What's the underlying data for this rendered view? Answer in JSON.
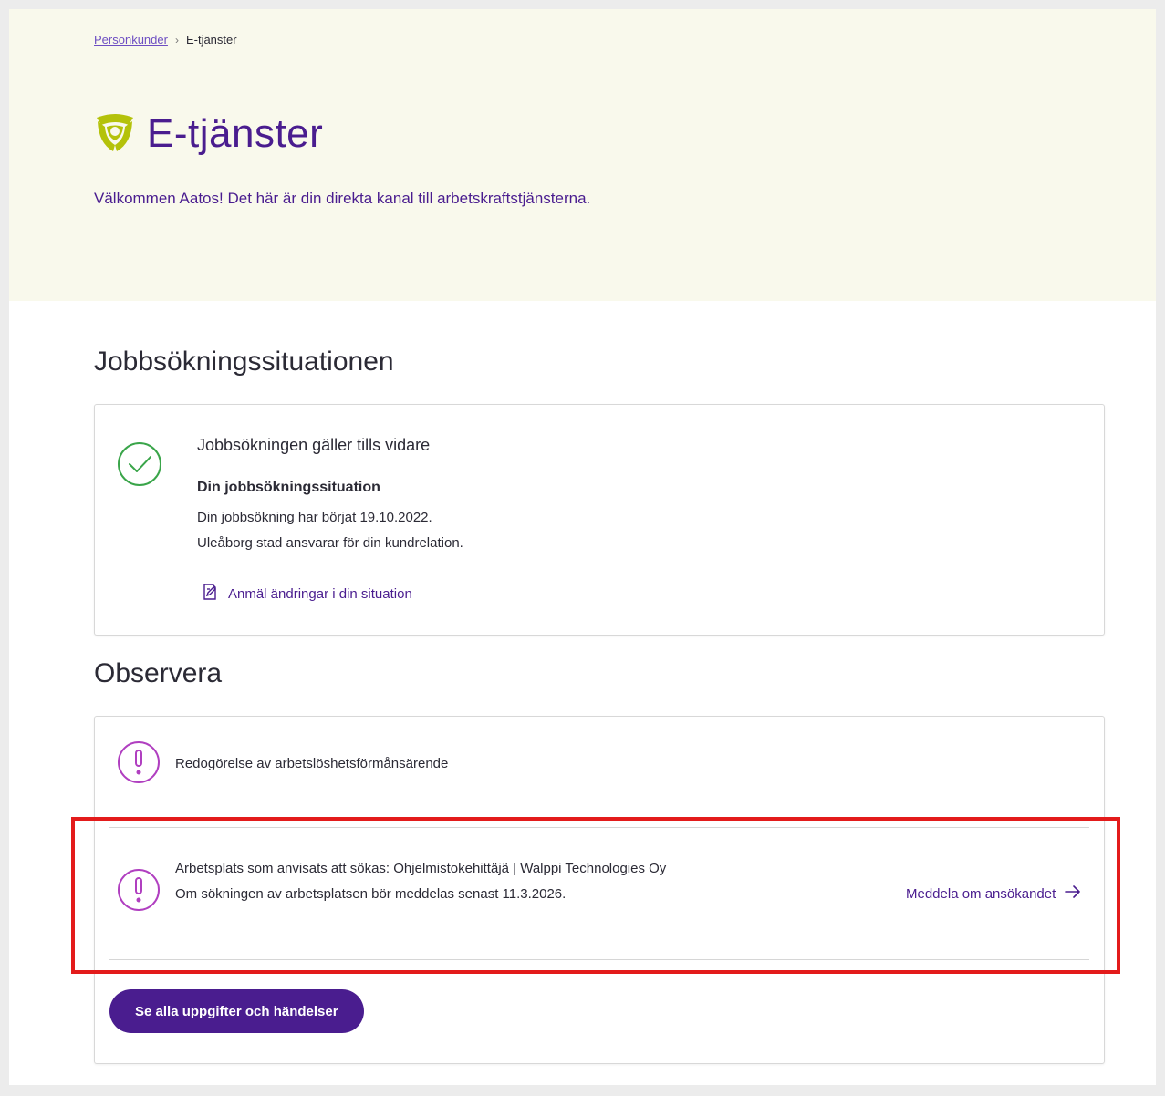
{
  "breadcrumb": {
    "home": "Personkunder",
    "separator": "›",
    "current": "E-tjänster"
  },
  "hero": {
    "title": "E-tjänster",
    "welcome": "Välkommen Aatos! Det här är din direkta kanal till arbetskraftstjänsterna.",
    "logo_icon": "brand-logo-icon"
  },
  "job_section": {
    "heading": "Jobbsökningssituationen",
    "status_icon": "check-circle-icon",
    "status_title": "Jobbsökningen gäller tills vidare",
    "subtitle": "Din jobbsökningssituation",
    "line1": "Din jobbsökning har börjat 19.10.2022.",
    "line2": "Uleåborg stad ansvarar för din kundrelation.",
    "change_link": "Anmäl ändringar i din situation",
    "change_icon": "edit-document-icon"
  },
  "observe_section": {
    "heading": "Observera",
    "items": [
      {
        "icon": "alert-circle-icon",
        "title": "Redogörelse av arbetslöshetsförmånsärende"
      },
      {
        "icon": "alert-circle-icon",
        "title": "Arbetsplats som anvisats att sökas: Ohjelmistokehittäjä | Walppi Technologies Oy",
        "detail": "Om sökningen av arbetsplatsen bör meddelas senast 11.3.2026.",
        "action": "Meddela om ansökandet",
        "action_icon": "arrow-right-icon"
      }
    ],
    "all_button": "Se alla uppgifter och händelser"
  },
  "colors": {
    "brand_purple": "#4a1d8f",
    "link_purple": "#6d4ec2",
    "hero_bg": "#f9f9ec",
    "success_green": "#3aa54a",
    "alert_magenta": "#b03fc0",
    "logo_green": "#b4c20a",
    "highlight_red": "#e31b1b"
  }
}
